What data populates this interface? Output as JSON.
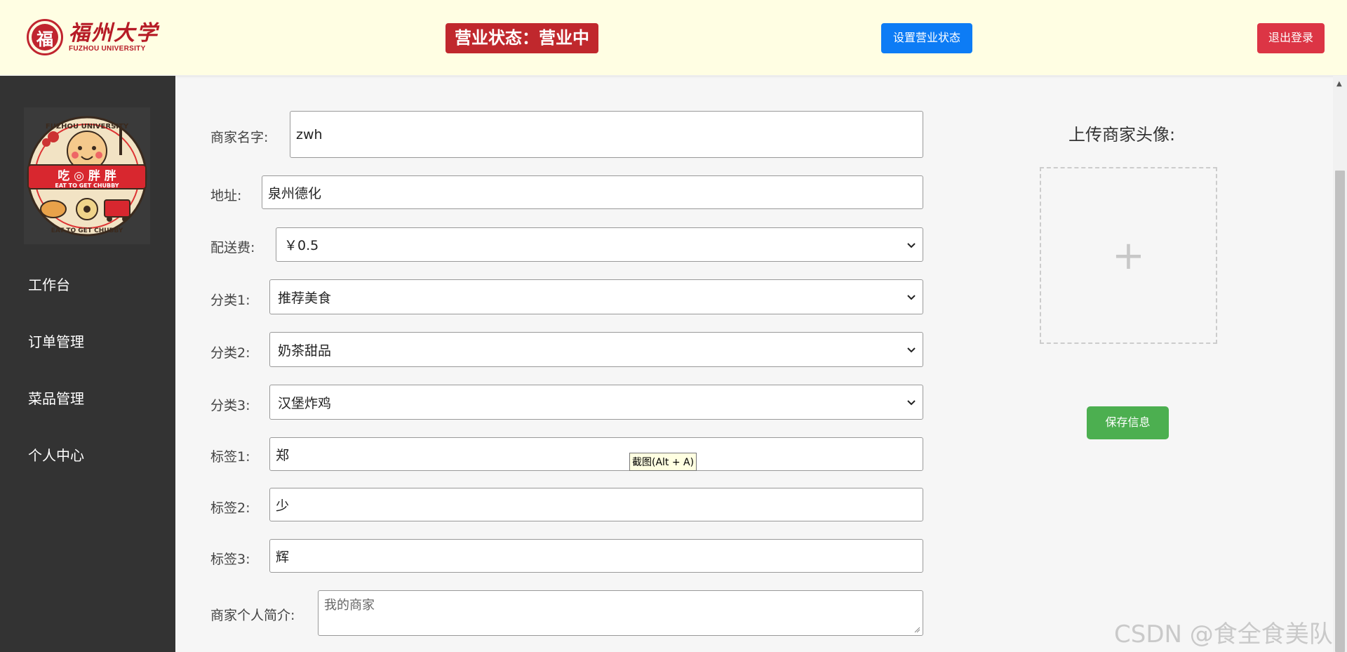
{
  "header": {
    "university_cn": "福州大学",
    "university_en": "FUZHOU UNIVERSITY",
    "seal_char": "福",
    "business_status": "营业状态：营业中",
    "set_status_label": "设置营业状态",
    "logout_label": "退出登录"
  },
  "mascot": {
    "top_arc": "FUZHOU UNIVERSITY",
    "banner": "吃 ◎ 胖 胖",
    "slogan": "EAT TO GET CHUBBY",
    "bottom_arc": "EAT TO GET CHUBBY"
  },
  "sidebar": {
    "items": [
      {
        "label": "工作台"
      },
      {
        "label": "订单管理"
      },
      {
        "label": "菜品管理"
      },
      {
        "label": "个人中心"
      }
    ]
  },
  "form": {
    "name_label": "商家名字:",
    "name_value": "zwh",
    "address_label": "地址:",
    "address_value": "泉州德化",
    "fee_label": "配送费:",
    "fee_value": "￥0.5",
    "cat1_label": "分类1:",
    "cat1_value": "推荐美食",
    "cat2_label": "分类2:",
    "cat2_value": "奶茶甜品",
    "cat3_label": "分类3:",
    "cat3_value": "汉堡炸鸡",
    "tag1_label": "标签1:",
    "tag1_value": "郑",
    "tag2_label": "标签2:",
    "tag2_value": "少",
    "tag3_label": "标签3:",
    "tag3_value": "辉",
    "intro_label": "商家个人简介:",
    "intro_placeholder": "我的商家"
  },
  "upload": {
    "title": "上传商家头像:",
    "plus": "+",
    "save_label": "保存信息"
  },
  "tooltip": "截图(Alt + A)",
  "watermark": "CSDN @食全食美队",
  "colors": {
    "header_bg": "#fffee3",
    "sidebar_bg": "#333333",
    "status_red": "#c0282d",
    "primary_blue": "#0d7cf5",
    "danger_red": "#dc3545",
    "save_green": "#4caf50"
  }
}
